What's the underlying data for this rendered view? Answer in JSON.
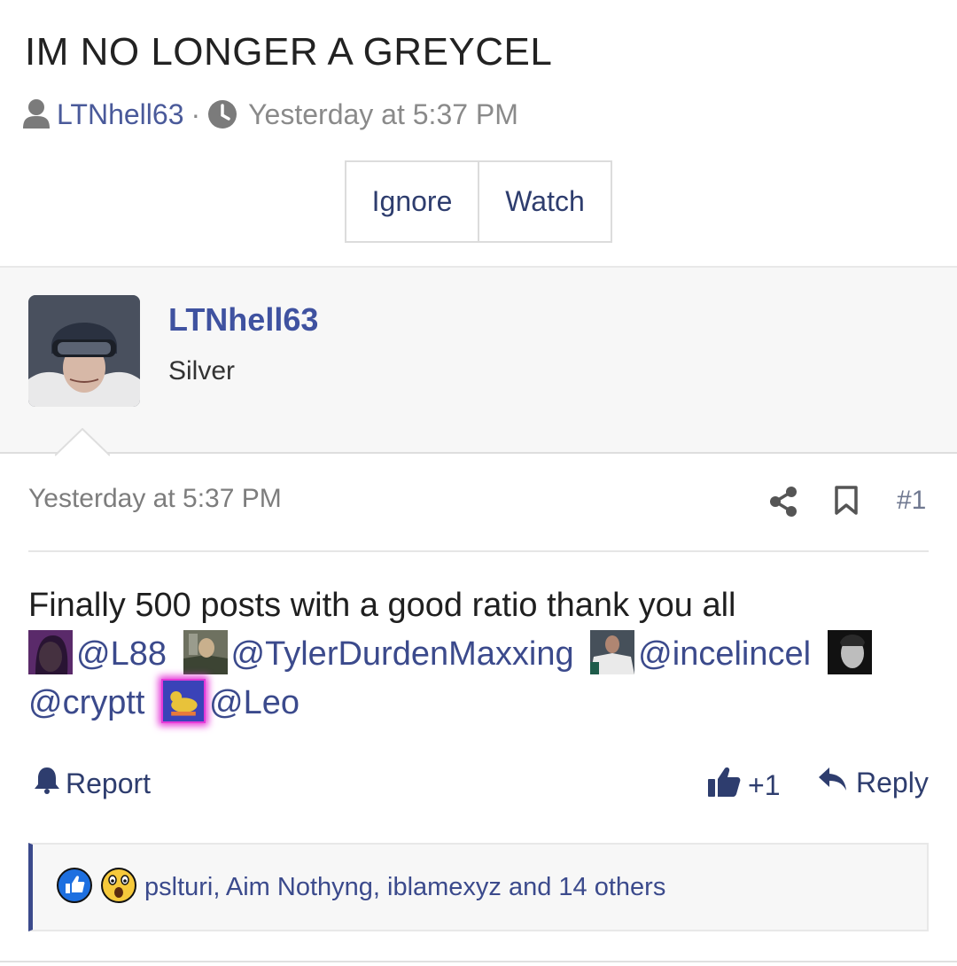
{
  "thread": {
    "title": "IM NO LONGER A GREYCEL",
    "author": "LTNhell63",
    "separator": "·",
    "date": "Yesterday at 5:37 PM"
  },
  "actions": {
    "ignore": "Ignore",
    "watch": "Watch"
  },
  "post": {
    "username": "LTNhell63",
    "rank": "Silver",
    "date": "Yesterday at 5:37 PM",
    "number": "#1",
    "text": "Finally 500 posts with a good ratio thank you all",
    "mentions": [
      "@L88",
      "@TylerDurdenMaxxing",
      "@incelincel",
      "@cryptt",
      "@Leo"
    ],
    "report": "Report",
    "like_count": "+1",
    "reply": "Reply"
  },
  "reactions": {
    "summary": "pslturi, Aim Nothyng, iblamexyz and 14 others"
  },
  "colors": {
    "link": "#3b4a8c",
    "username": "#3f52a0",
    "muted": "#8a8a8a",
    "panel": "#f7f7f7"
  },
  "icons": [
    "user-icon",
    "clock-icon",
    "share-icon",
    "bookmark-icon",
    "bell-icon",
    "thumbs-up-icon",
    "reply-icon",
    "like-reaction-icon",
    "wow-reaction-icon"
  ]
}
